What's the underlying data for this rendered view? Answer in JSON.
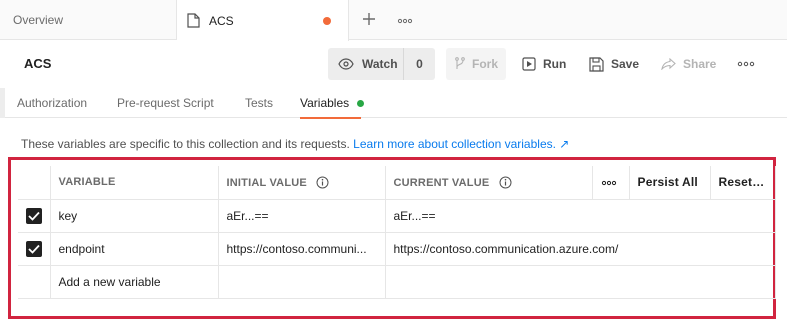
{
  "tabs": {
    "overview_label": "Overview",
    "active_label": "ACS",
    "unsaved_color": "#f26b3a"
  },
  "header": {
    "title": "ACS",
    "watch_label": "Watch",
    "watch_count": "0",
    "fork_label": "Fork",
    "run_label": "Run",
    "save_label": "Save",
    "share_label": "Share"
  },
  "subtabs": {
    "authorization": "Authorization",
    "prerequest": "Pre-request Script",
    "tests": "Tests",
    "variables": "Variables"
  },
  "info": {
    "text": "These variables are specific to this collection and its requests.",
    "link": "Learn more about collection variables. ↗"
  },
  "table": {
    "headers": {
      "variable": "VARIABLE",
      "initial_value": "INITIAL VALUE",
      "current_value": "CURRENT VALUE",
      "persist_all": "Persist All",
      "reset_all": "Reset All"
    },
    "rows": [
      {
        "variable": "key",
        "initial_value": "aEr...==",
        "current_value": "aEr...==",
        "enabled": true
      },
      {
        "variable": "endpoint",
        "initial_value": "https://contoso.communi...",
        "current_value": "https://contoso.communication.azure.com/",
        "enabled": true
      }
    ],
    "new_variable_placeholder": "Add a new variable"
  },
  "icons": {
    "tab": "document-icon",
    "new_tab": "plus-icon",
    "tab_menu": "more-horizontal-icon",
    "watch": "eye-icon",
    "fork": "fork-icon",
    "run": "play-icon",
    "save": "save-icon",
    "share": "share-icon",
    "info": "info-icon",
    "checkbox": "check-icon"
  },
  "colors": {
    "accent": "#f26b3a",
    "link": "#097bed",
    "active_dot": "#28a745",
    "highlight": "#d1243f"
  }
}
